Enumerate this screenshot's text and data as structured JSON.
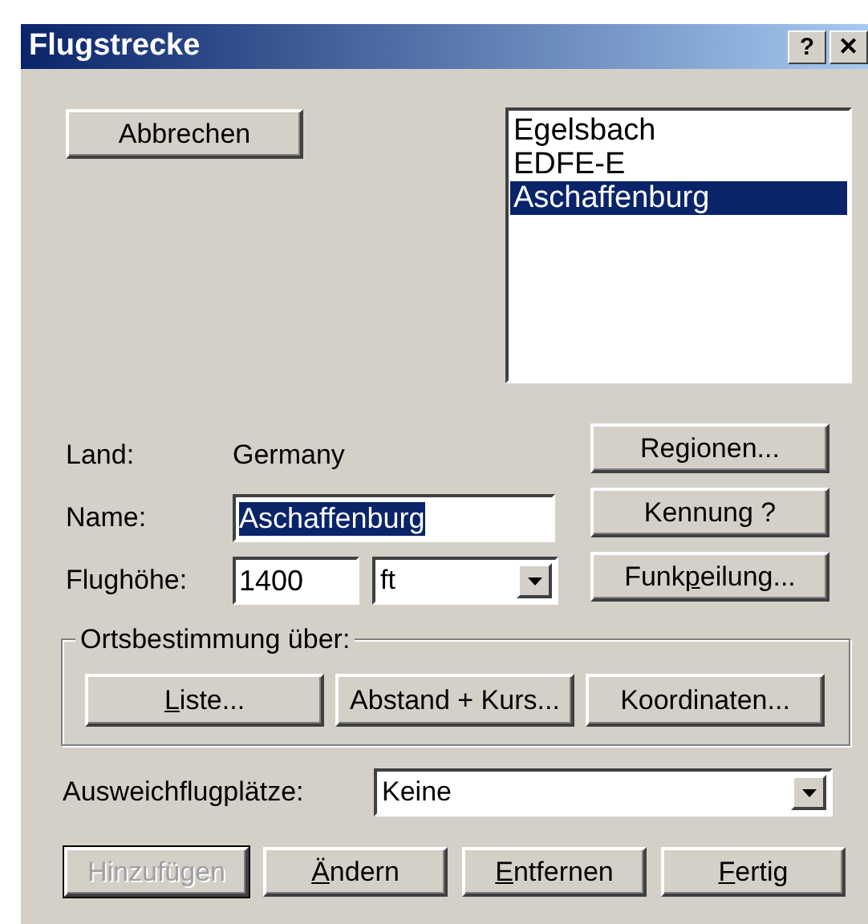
{
  "window": {
    "title": "Flugstrecke",
    "help_button": "?",
    "close_button": "✕"
  },
  "cancel_button": {
    "after": "Abbrechen"
  },
  "airfield_list": [
    {
      "label": "Egelsbach",
      "selected": false
    },
    {
      "label": "EDFE-E",
      "selected": false
    },
    {
      "label": "Aschaffenburg",
      "selected": true
    }
  ],
  "country": {
    "label": "Land:",
    "value": "Germany"
  },
  "name": {
    "label": "Name:",
    "value": "Aschaffenburg",
    "selected": true
  },
  "altitude": {
    "label": "Flughöhe:",
    "value": "1400",
    "unit": "ft"
  },
  "side_buttons": [
    {
      "after": "Regionen..."
    },
    {
      "after": "Kennung ?"
    },
    {
      "before": "Funk",
      "key": "p",
      "after": "eilung..."
    }
  ],
  "position_group": {
    "legend": "Ortsbestimmung über:",
    "buttons": [
      {
        "key": "L",
        "after": "iste..."
      },
      {
        "after": "Abstand + Kurs..."
      },
      {
        "after": "Koordinaten..."
      }
    ]
  },
  "alternates": {
    "label": "Ausweichflugplätze:",
    "value": "Keine"
  },
  "bottom_buttons": [
    {
      "after": "Hinzufügen",
      "disabled": true,
      "default": true
    },
    {
      "key": "Ä",
      "after": "ndern",
      "disabled": false,
      "default": false
    },
    {
      "key": "E",
      "after": "ntfernen",
      "disabled": false,
      "default": false
    },
    {
      "key": "F",
      "after": "ertig",
      "disabled": false,
      "default": false
    }
  ]
}
